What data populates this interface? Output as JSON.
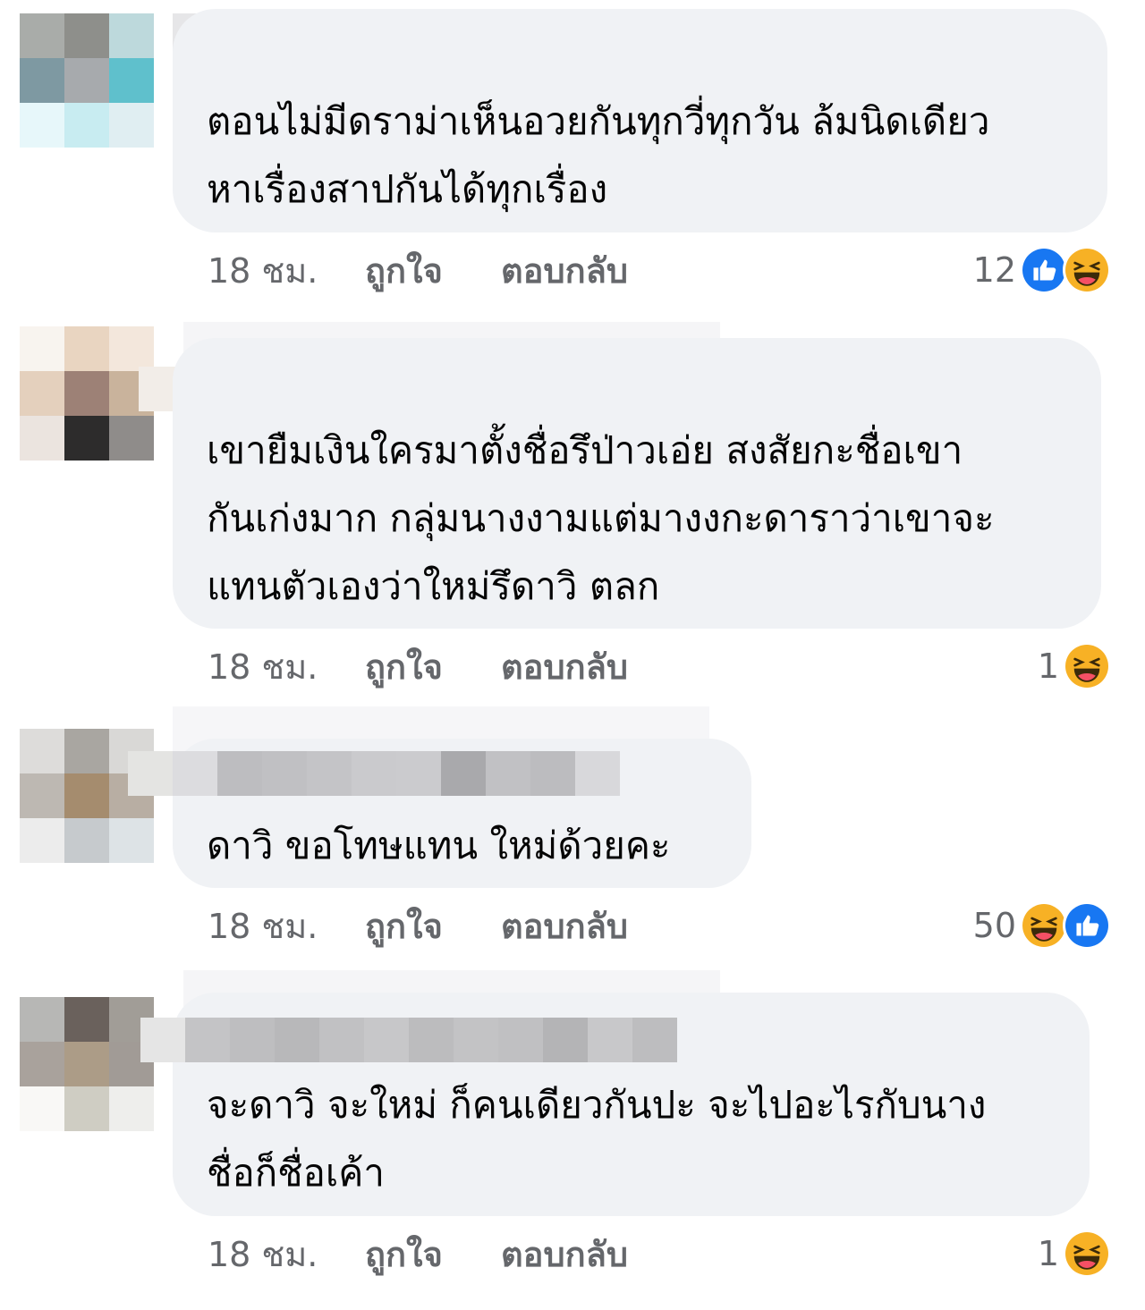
{
  "comments": [
    {
      "text": "ตอนไม่มีดราม่าเห็นอวยกันทุกวี่ทุกวัน ล้มนิดเดียว\nหาเรื่องสาปกันได้ทุกเรื่อง",
      "time": "18 ชม.",
      "like_label": "ถูกใจ",
      "reply_label": "ตอบกลับ",
      "reaction_count": "12",
      "reactions": [
        "like-icon",
        "haha-icon"
      ]
    },
    {
      "text": "เขายืมเงินใครมาตั้งชื่อรึป่าวเอ่ย สงสัยกะชื่อเขา\nกันเก่งมาก กลุ่มนางงามแต่มางงกะดาราว่าเขาจะ\nแทนตัวเองว่าใหม่รึดาวิ ตลก",
      "time": "18 ชม.",
      "like_label": "ถูกใจ",
      "reply_label": "ตอบกลับ",
      "reaction_count": "1",
      "reactions": [
        "haha-icon"
      ]
    },
    {
      "text": "ดาวิ ขอโทษแทน ใหม่ด้วยคะ",
      "time": "18 ชม.",
      "like_label": "ถูกใจ",
      "reply_label": "ตอบกลับ",
      "reaction_count": "50",
      "reactions": [
        "haha-icon",
        "like-icon"
      ]
    },
    {
      "text": "จะดาวิ จะใหม่ ก็คนเดียวกันปะ จะไปอะไรกับนาง\nชื่อก็ชื่อเค้า",
      "time": "18 ชม.",
      "like_label": "ถูกใจ",
      "reply_label": "ตอบกลับ",
      "reaction_count": "1",
      "reactions": [
        "haha-icon"
      ]
    }
  ],
  "colors": {
    "bubble": "#f0f2f5",
    "meta_text": "#65676b",
    "like_blue": "#1877f2",
    "haha_yellow": "#f7b125"
  }
}
